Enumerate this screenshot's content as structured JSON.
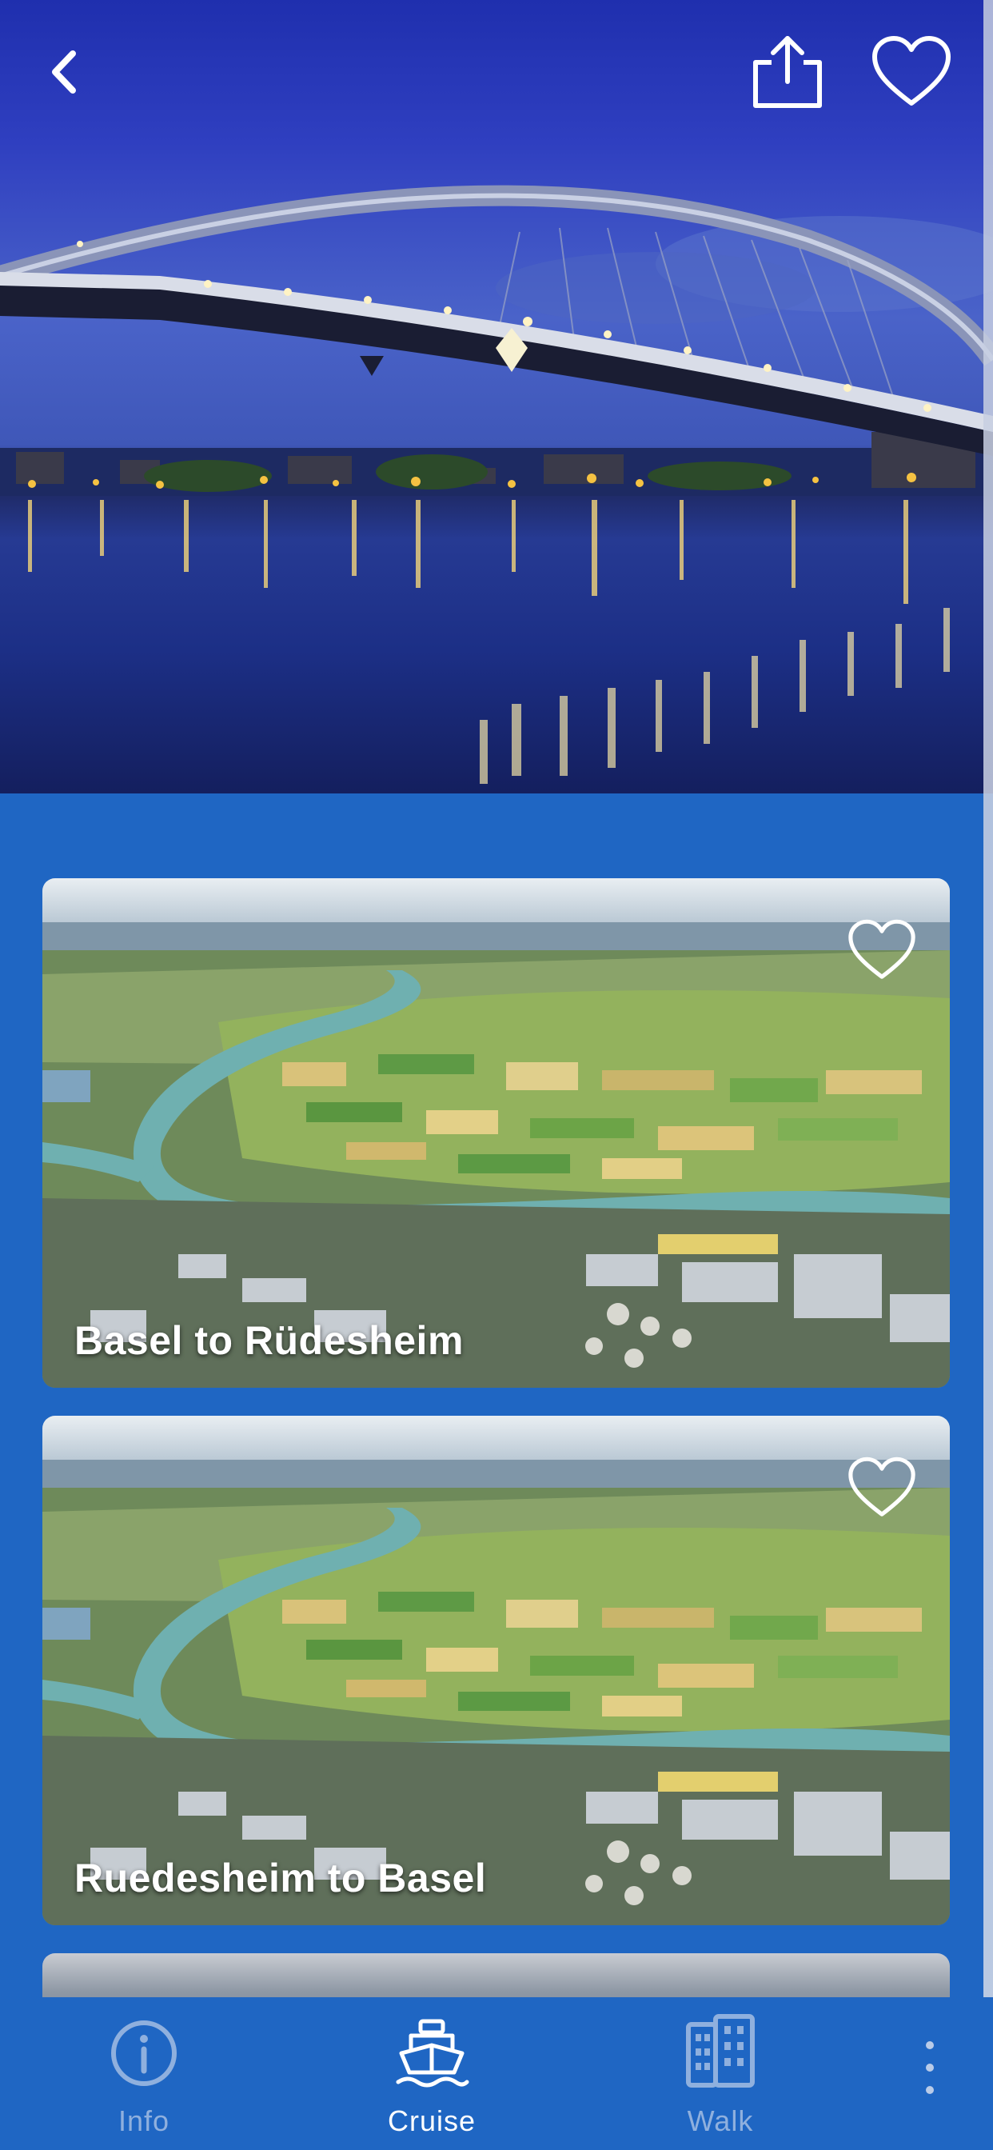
{
  "hero": {
    "back_icon": "chevron-left-icon",
    "share_icon": "share-icon",
    "favorite_icon": "heart-outline-icon"
  },
  "cards": [
    {
      "title": "Basel to Rüdesheim",
      "favorite_icon": "heart-outline-icon"
    },
    {
      "title": "Ruedesheim to Basel",
      "favorite_icon": "heart-outline-icon"
    }
  ],
  "tabbar": {
    "tabs": [
      {
        "label": "Info",
        "icon": "info-circle-icon",
        "active": false
      },
      {
        "label": "Cruise",
        "icon": "ship-icon",
        "active": true
      },
      {
        "label": "Walk",
        "icon": "buildings-icon",
        "active": false
      }
    ],
    "more_icon": "more-vertical-icon"
  },
  "colors": {
    "background": "#1f66c3",
    "tab_active": "#ffffff",
    "tab_inactive": "#8fb0de"
  }
}
